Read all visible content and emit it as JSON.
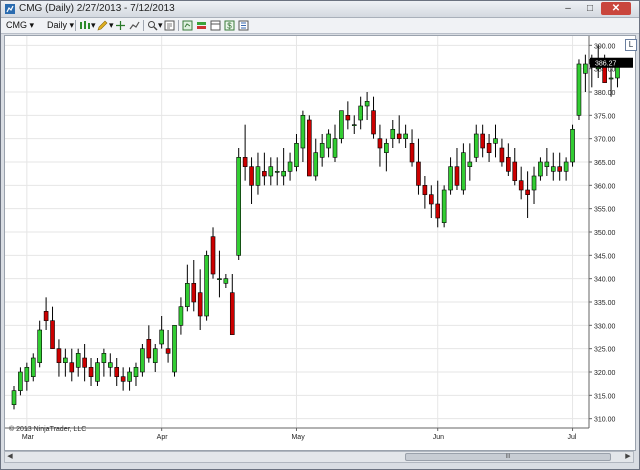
{
  "window": {
    "title": "CMG (Daily)  2/27/2013 - 7/12/2013",
    "minimize": "–",
    "maximize": "□",
    "close": "✕"
  },
  "toolbar": {
    "instrument": "CMG",
    "interval": "Daily",
    "dropdown_glyph": "▾",
    "icons": [
      "bars-type-icon",
      "drawing-pencil-icon",
      "crosshair-icon",
      "indicator-icon",
      "zoom-icon",
      "properties-icon",
      "strategies-icon",
      "chart-trader-icon",
      "data-box-icon",
      "dollar-icon",
      "data-series-icon"
    ]
  },
  "chart": {
    "scale_button": "L",
    "copyright": "© 2013 NinjaTrader, LLC",
    "scroll_thumb_label": "III",
    "colors": {
      "up": "#32cd32",
      "down": "#cc0000",
      "grid": "#e6e6e6",
      "last_price_bg": "#000000"
    }
  },
  "chart_data": {
    "type": "candlestick",
    "symbol": "CMG",
    "interval": "Daily",
    "date_range": "2/27/2013 - 7/12/2013",
    "ylim": [
      308,
      392
    ],
    "yticks": [
      310,
      315,
      320,
      325,
      330,
      335,
      340,
      345,
      350,
      355,
      360,
      365,
      370,
      375,
      380,
      385,
      390
    ],
    "ytick_labels": [
      "310.00",
      "315.00",
      "320.00",
      "325.00",
      "330.00",
      "335.00",
      "340.00",
      "345.00",
      "350.00",
      "355.00",
      "360.00",
      "365.00",
      "370.00",
      "375.00",
      "380.00",
      "385.00",
      "390.00"
    ],
    "xticks": [
      {
        "label": "Mar",
        "index": 2
      },
      {
        "label": "Apr",
        "index": 23
      },
      {
        "label": "May",
        "index": 44
      },
      {
        "label": "Jun",
        "index": 66
      },
      {
        "label": "Jul",
        "index": 87
      }
    ],
    "last_price": 386.27,
    "last_price_label": "386.27",
    "candles": [
      [
        313,
        317,
        312,
        316
      ],
      [
        316,
        321,
        315,
        320
      ],
      [
        318,
        322,
        316,
        321
      ],
      [
        319,
        324,
        318,
        323
      ],
      [
        322,
        331,
        321,
        329
      ],
      [
        333,
        336,
        329,
        331
      ],
      [
        331,
        334,
        325,
        325
      ],
      [
        325,
        327,
        319,
        322
      ],
      [
        322,
        325,
        319,
        323
      ],
      [
        322,
        325,
        318,
        320
      ],
      [
        321,
        325,
        319,
        324
      ],
      [
        323,
        326,
        318,
        321
      ],
      [
        321,
        323,
        317,
        319
      ],
      [
        318,
        323,
        317,
        322
      ],
      [
        322,
        325,
        319,
        324
      ],
      [
        321,
        324,
        319,
        322
      ],
      [
        321,
        323,
        317,
        319
      ],
      [
        319,
        321,
        316,
        318
      ],
      [
        318,
        321,
        316,
        320
      ],
      [
        319,
        322,
        317,
        321
      ],
      [
        320,
        326,
        319,
        325
      ],
      [
        327,
        330,
        322,
        323
      ],
      [
        322,
        326,
        320,
        325
      ],
      [
        326,
        332,
        325,
        329
      ],
      [
        325,
        329,
        322,
        324
      ],
      [
        320,
        330,
        319,
        330
      ],
      [
        330,
        336,
        328,
        334
      ],
      [
        334,
        343,
        333,
        339
      ],
      [
        339,
        344,
        333,
        335
      ],
      [
        337,
        342,
        329,
        332
      ],
      [
        332,
        346,
        331,
        345
      ],
      [
        349,
        351,
        340,
        341
      ],
      [
        340,
        346,
        336,
        340
      ],
      [
        339,
        341,
        338,
        340
      ],
      [
        337,
        341,
        328,
        328
      ],
      [
        345,
        368,
        344,
        366
      ],
      [
        366,
        373,
        361,
        364
      ],
      [
        364,
        366,
        356,
        360
      ],
      [
        360,
        367,
        358,
        364
      ],
      [
        363,
        367,
        360,
        362
      ],
      [
        362,
        366,
        360,
        364
      ],
      [
        363,
        366,
        360,
        363
      ],
      [
        362,
        368,
        360,
        363
      ],
      [
        363,
        367,
        361,
        365
      ],
      [
        364,
        371,
        363,
        369
      ],
      [
        368,
        376,
        365,
        375
      ],
      [
        374,
        375,
        362,
        362
      ],
      [
        362,
        370,
        361,
        367
      ],
      [
        366,
        371,
        364,
        369
      ],
      [
        368,
        372,
        366,
        371
      ],
      [
        366,
        373,
        365,
        370
      ],
      [
        370,
        376,
        369,
        376
      ],
      [
        375,
        378,
        372,
        374
      ],
      [
        373,
        375,
        371,
        373
      ],
      [
        374,
        379,
        372,
        377
      ],
      [
        377,
        380,
        374,
        378
      ],
      [
        376,
        379,
        370,
        371
      ],
      [
        370,
        373,
        364,
        368
      ],
      [
        367,
        370,
        363,
        369
      ],
      [
        370,
        374,
        368,
        372
      ],
      [
        371,
        375,
        369,
        370
      ],
      [
        370,
        373,
        368,
        371
      ],
      [
        369,
        372,
        364,
        365
      ],
      [
        365,
        370,
        358,
        360
      ],
      [
        360,
        362,
        355,
        358
      ],
      [
        358,
        360,
        353,
        356
      ],
      [
        356,
        361,
        351,
        353
      ],
      [
        352,
        360,
        351,
        359
      ],
      [
        359,
        366,
        358,
        364
      ],
      [
        364,
        368,
        359,
        360
      ],
      [
        359,
        369,
        358,
        367
      ],
      [
        364,
        369,
        361,
        365
      ],
      [
        366,
        373,
        365,
        371
      ],
      [
        371,
        373,
        366,
        368
      ],
      [
        369,
        371,
        365,
        367
      ],
      [
        369,
        373,
        366,
        370
      ],
      [
        368,
        370,
        364,
        365
      ],
      [
        366,
        369,
        362,
        363
      ],
      [
        365,
        368,
        360,
        361
      ],
      [
        361,
        364,
        357,
        359
      ],
      [
        359,
        363,
        353,
        358
      ],
      [
        359,
        364,
        356,
        362
      ],
      [
        362,
        366,
        361,
        365
      ],
      [
        364,
        368,
        362,
        365
      ],
      [
        363,
        367,
        361,
        364
      ],
      [
        364,
        367,
        361,
        363
      ],
      [
        363,
        366,
        361,
        365
      ],
      [
        365,
        373,
        364,
        372
      ],
      [
        375,
        387,
        374,
        386
      ],
      [
        384,
        388,
        380,
        386
      ],
      [
        386,
        388,
        381,
        387
      ],
      [
        385,
        390,
        383,
        387
      ],
      [
        387,
        388,
        382,
        382
      ],
      [
        383,
        385,
        379,
        383
      ],
      [
        383,
        387,
        381,
        386
      ]
    ]
  }
}
